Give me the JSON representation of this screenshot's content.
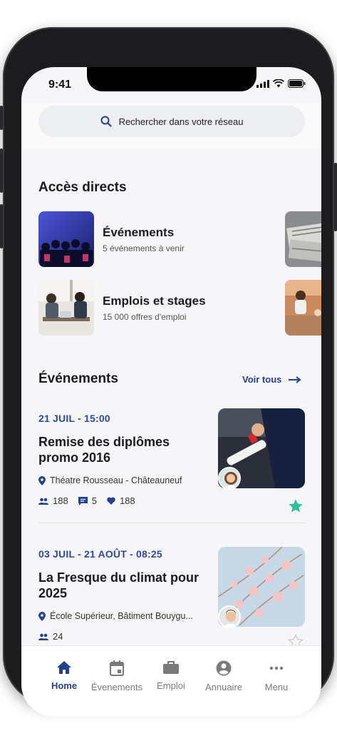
{
  "status": {
    "time": "9:41"
  },
  "search": {
    "placeholder": "Rechercher dans votre réseau"
  },
  "quick_access": {
    "title": "Accès directs",
    "tiles": [
      {
        "title": "Événements",
        "subtitle": "5 événements à venir"
      },
      {
        "title": "Emplois et stages",
        "subtitle": "15 000 offres d'emploi"
      }
    ]
  },
  "events_section": {
    "title": "Événements",
    "see_all": "Voir tous",
    "items": [
      {
        "date": "21 JUIL - 15:00",
        "title": "Remise des diplômes promo 2016",
        "location": "Théatre Rousseau - Châteauneuf",
        "participants": "188",
        "comments": "5",
        "likes": "188",
        "favorite": true
      },
      {
        "date": "03 JUIL - 21 AOÛT - 08:25",
        "title": "La Fresque du climat pour 2025",
        "location": "École Supérieur, Bâtiment Bouygu...",
        "participants": "24",
        "favorite": false
      }
    ]
  },
  "tabbar": {
    "items": [
      {
        "label": "Home",
        "icon": "home-icon",
        "active": true
      },
      {
        "label": "Évenements",
        "icon": "calendar-icon",
        "active": false
      },
      {
        "label": "Emploi",
        "icon": "briefcase-icon",
        "active": false
      },
      {
        "label": "Annuaire",
        "icon": "account-icon",
        "active": false
      },
      {
        "label": "Menu",
        "icon": "more-icon",
        "active": false
      }
    ]
  },
  "colors": {
    "accent": "#24418f",
    "favorite": "#2bbf9a",
    "text": "#1b1b1f"
  }
}
